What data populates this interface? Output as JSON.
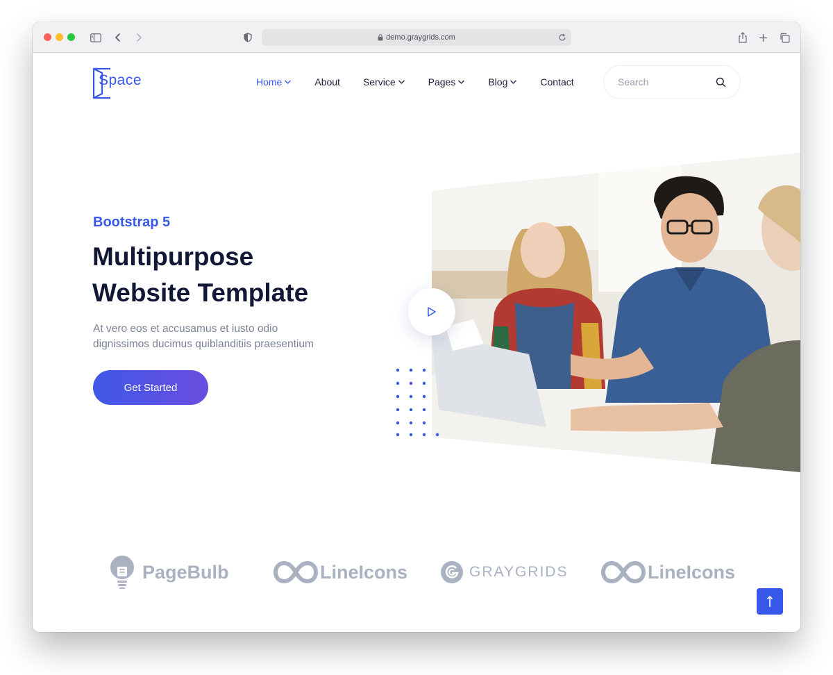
{
  "browser": {
    "url": "demo.graygrids.com"
  },
  "header": {
    "logo_text": "Space",
    "nav": [
      {
        "label": "Home",
        "dropdown": true,
        "active": true
      },
      {
        "label": "About",
        "dropdown": false
      },
      {
        "label": "Service",
        "dropdown": true
      },
      {
        "label": "Pages",
        "dropdown": true
      },
      {
        "label": "Blog",
        "dropdown": true
      },
      {
        "label": "Contact",
        "dropdown": false
      }
    ],
    "search_placeholder": "Search"
  },
  "hero": {
    "eyebrow": "Bootstrap 5",
    "title_line1": "Multipurpose",
    "title_line2": "Website Template",
    "description_line1": "At vero eos et accusamus et iusto odio",
    "description_line2": "dignissimos ducimus quiblanditiis praesentium",
    "cta_label": "Get Started"
  },
  "brands": [
    {
      "name": "PageBulb",
      "icon": "bulb-icon"
    },
    {
      "name": "LineIcons",
      "icon": "infinity-icon"
    },
    {
      "name": "GRAYGRIDS",
      "icon": "graygrids-icon"
    },
    {
      "name": "LineIcons",
      "icon": "infinity-icon"
    }
  ],
  "colors": {
    "accent": "#3758e8",
    "heading": "#111836",
    "body_text": "#7c8397",
    "brand_gray": "#aab1c1"
  }
}
